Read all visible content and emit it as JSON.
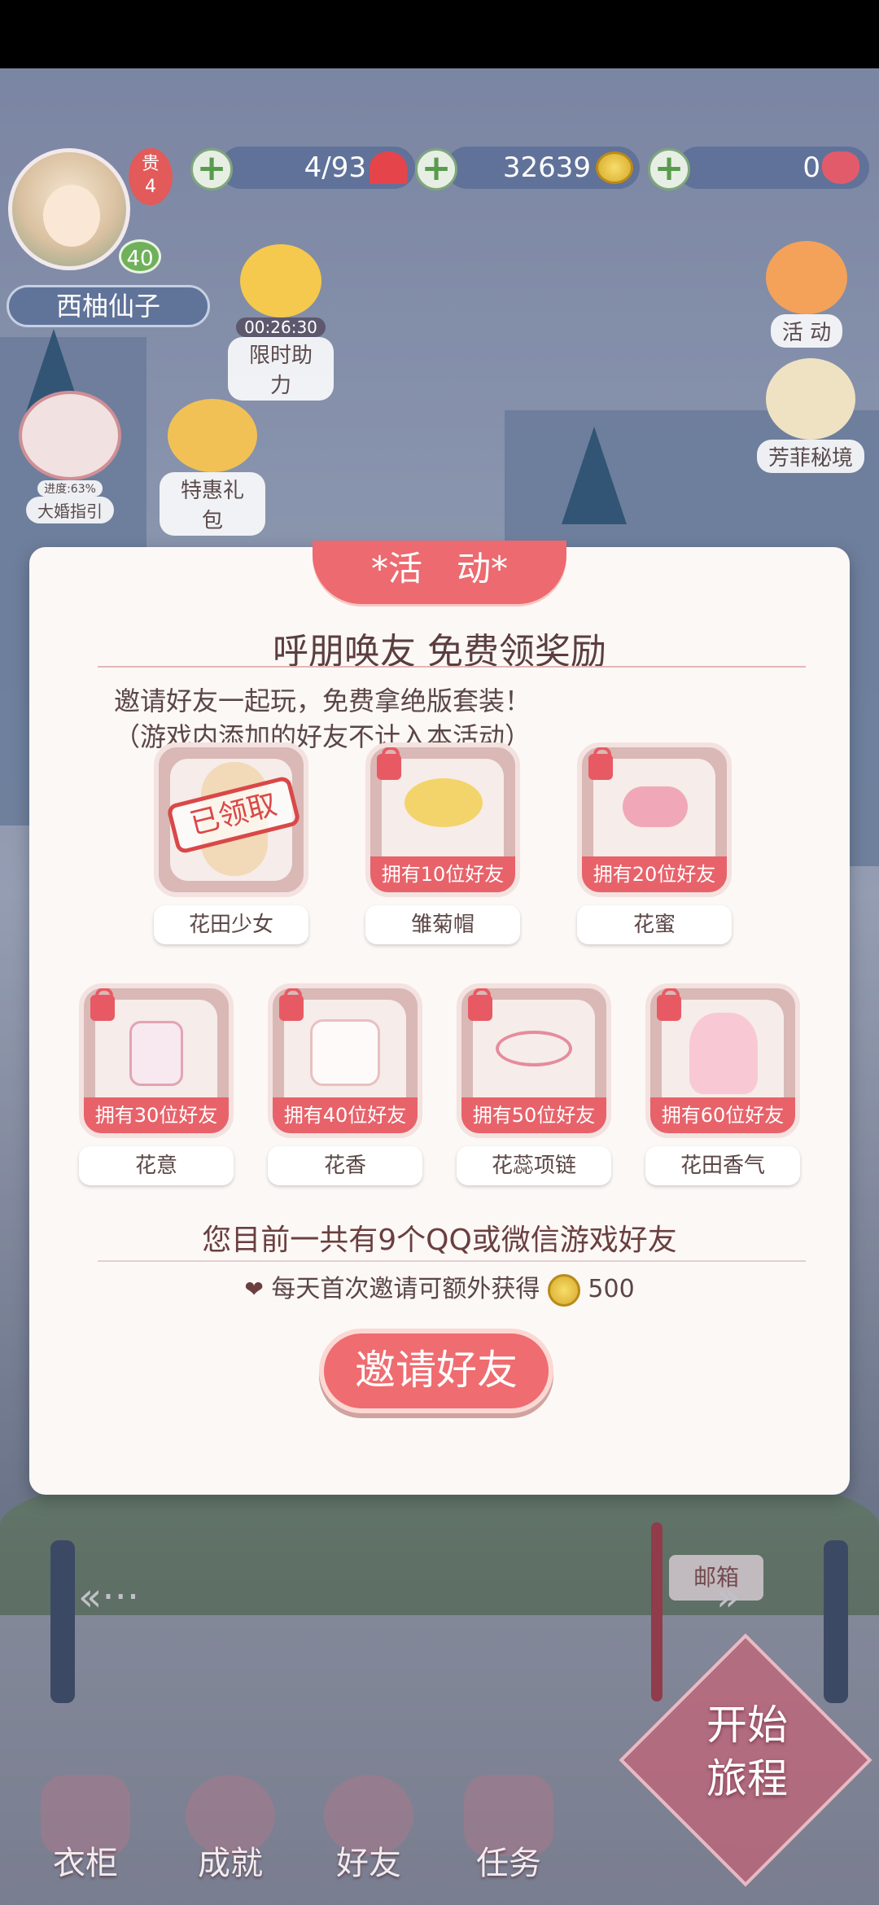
{
  "hud": {
    "vip": "贵\n4",
    "level": "40",
    "player_name": "西柚仙子",
    "stamina": "4/93",
    "coins": "32639",
    "gems": "0",
    "limited_help": {
      "timer": "00:26:30",
      "label": "限时助力"
    },
    "special_pack": "特惠礼包",
    "big_wedding": {
      "progress": "进度:63%",
      "label": "大婚指引"
    },
    "activity": "活 动",
    "fragrance": "芳菲秘境"
  },
  "dialog": {
    "tab": "*活　动*",
    "title": "呼朋唤友 免费领奖励",
    "desc1": "邀请好友一起玩，免费拿绝版套装！",
    "desc2": "（游戏内添加的好友不计入本活动）",
    "rewards_row1": [
      {
        "name": "花田少女",
        "status": "已领取"
      },
      {
        "name": "雏菊帽",
        "req": "拥有10位好友"
      },
      {
        "name": "花蜜",
        "req": "拥有20位好友"
      }
    ],
    "rewards_row2": [
      {
        "name": "花意",
        "req": "拥有30位好友"
      },
      {
        "name": "花香",
        "req": "拥有40位好友"
      },
      {
        "name": "花蕊项链",
        "req": "拥有50位好友"
      },
      {
        "name": "花田香气",
        "req": "拥有60位好友"
      }
    ],
    "friend_count": "您目前一共有9个QQ或微信游戏好友",
    "bonus_text": "每天首次邀请可额外获得",
    "bonus_amount": "500",
    "invite_button": "邀请好友"
  },
  "scene": {
    "mailbox": "邮箱"
  },
  "nav": {
    "wardrobe": "衣柜",
    "achievements": "成就",
    "friends": "好友",
    "tasks": "任务",
    "start_line1": "开始",
    "start_line2": "旅程"
  }
}
